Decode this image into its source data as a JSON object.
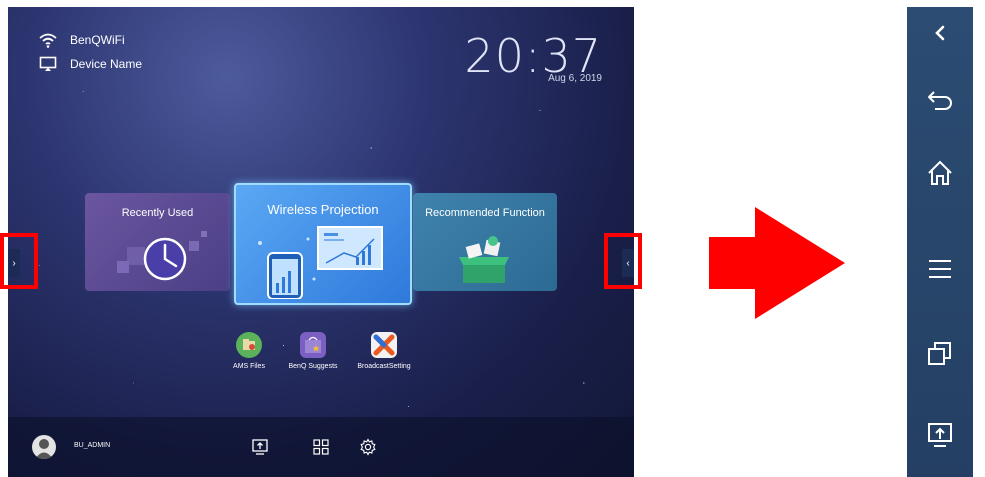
{
  "status_bar": {
    "wifi_label": "BenQWiFi",
    "device_label": "Device Name",
    "clock": "20:37",
    "date": "Aug 6, 2019"
  },
  "cards": {
    "recently_used": "Recently Used",
    "wireless_projection": "Wireless Projection",
    "recommended_function": "Recommended Function"
  },
  "apps": [
    {
      "label": "AMS Files",
      "icon": "folder-icon"
    },
    {
      "label": "BenQ Suggests",
      "icon": "shopping-bag-icon"
    },
    {
      "label": "BroadcastSetting",
      "icon": "broadcast-icon"
    }
  ],
  "bottom_bar": {
    "username": "BU_ADMIN",
    "icons": [
      "screen-share-icon",
      "apps-grid-icon",
      "settings-icon"
    ]
  },
  "side_buttons": {
    "left": "›",
    "right": "‹"
  },
  "control_panel": {
    "icons": [
      "chevron-left-icon",
      "back-icon",
      "home-icon",
      "menu-icon",
      "multitask-icon",
      "screen-share-icon"
    ]
  },
  "colors": {
    "highlight_box": "#ff0000",
    "arrow": "#ff0000",
    "panel": "#2a4870",
    "selected_card": "#3f8ee8"
  }
}
